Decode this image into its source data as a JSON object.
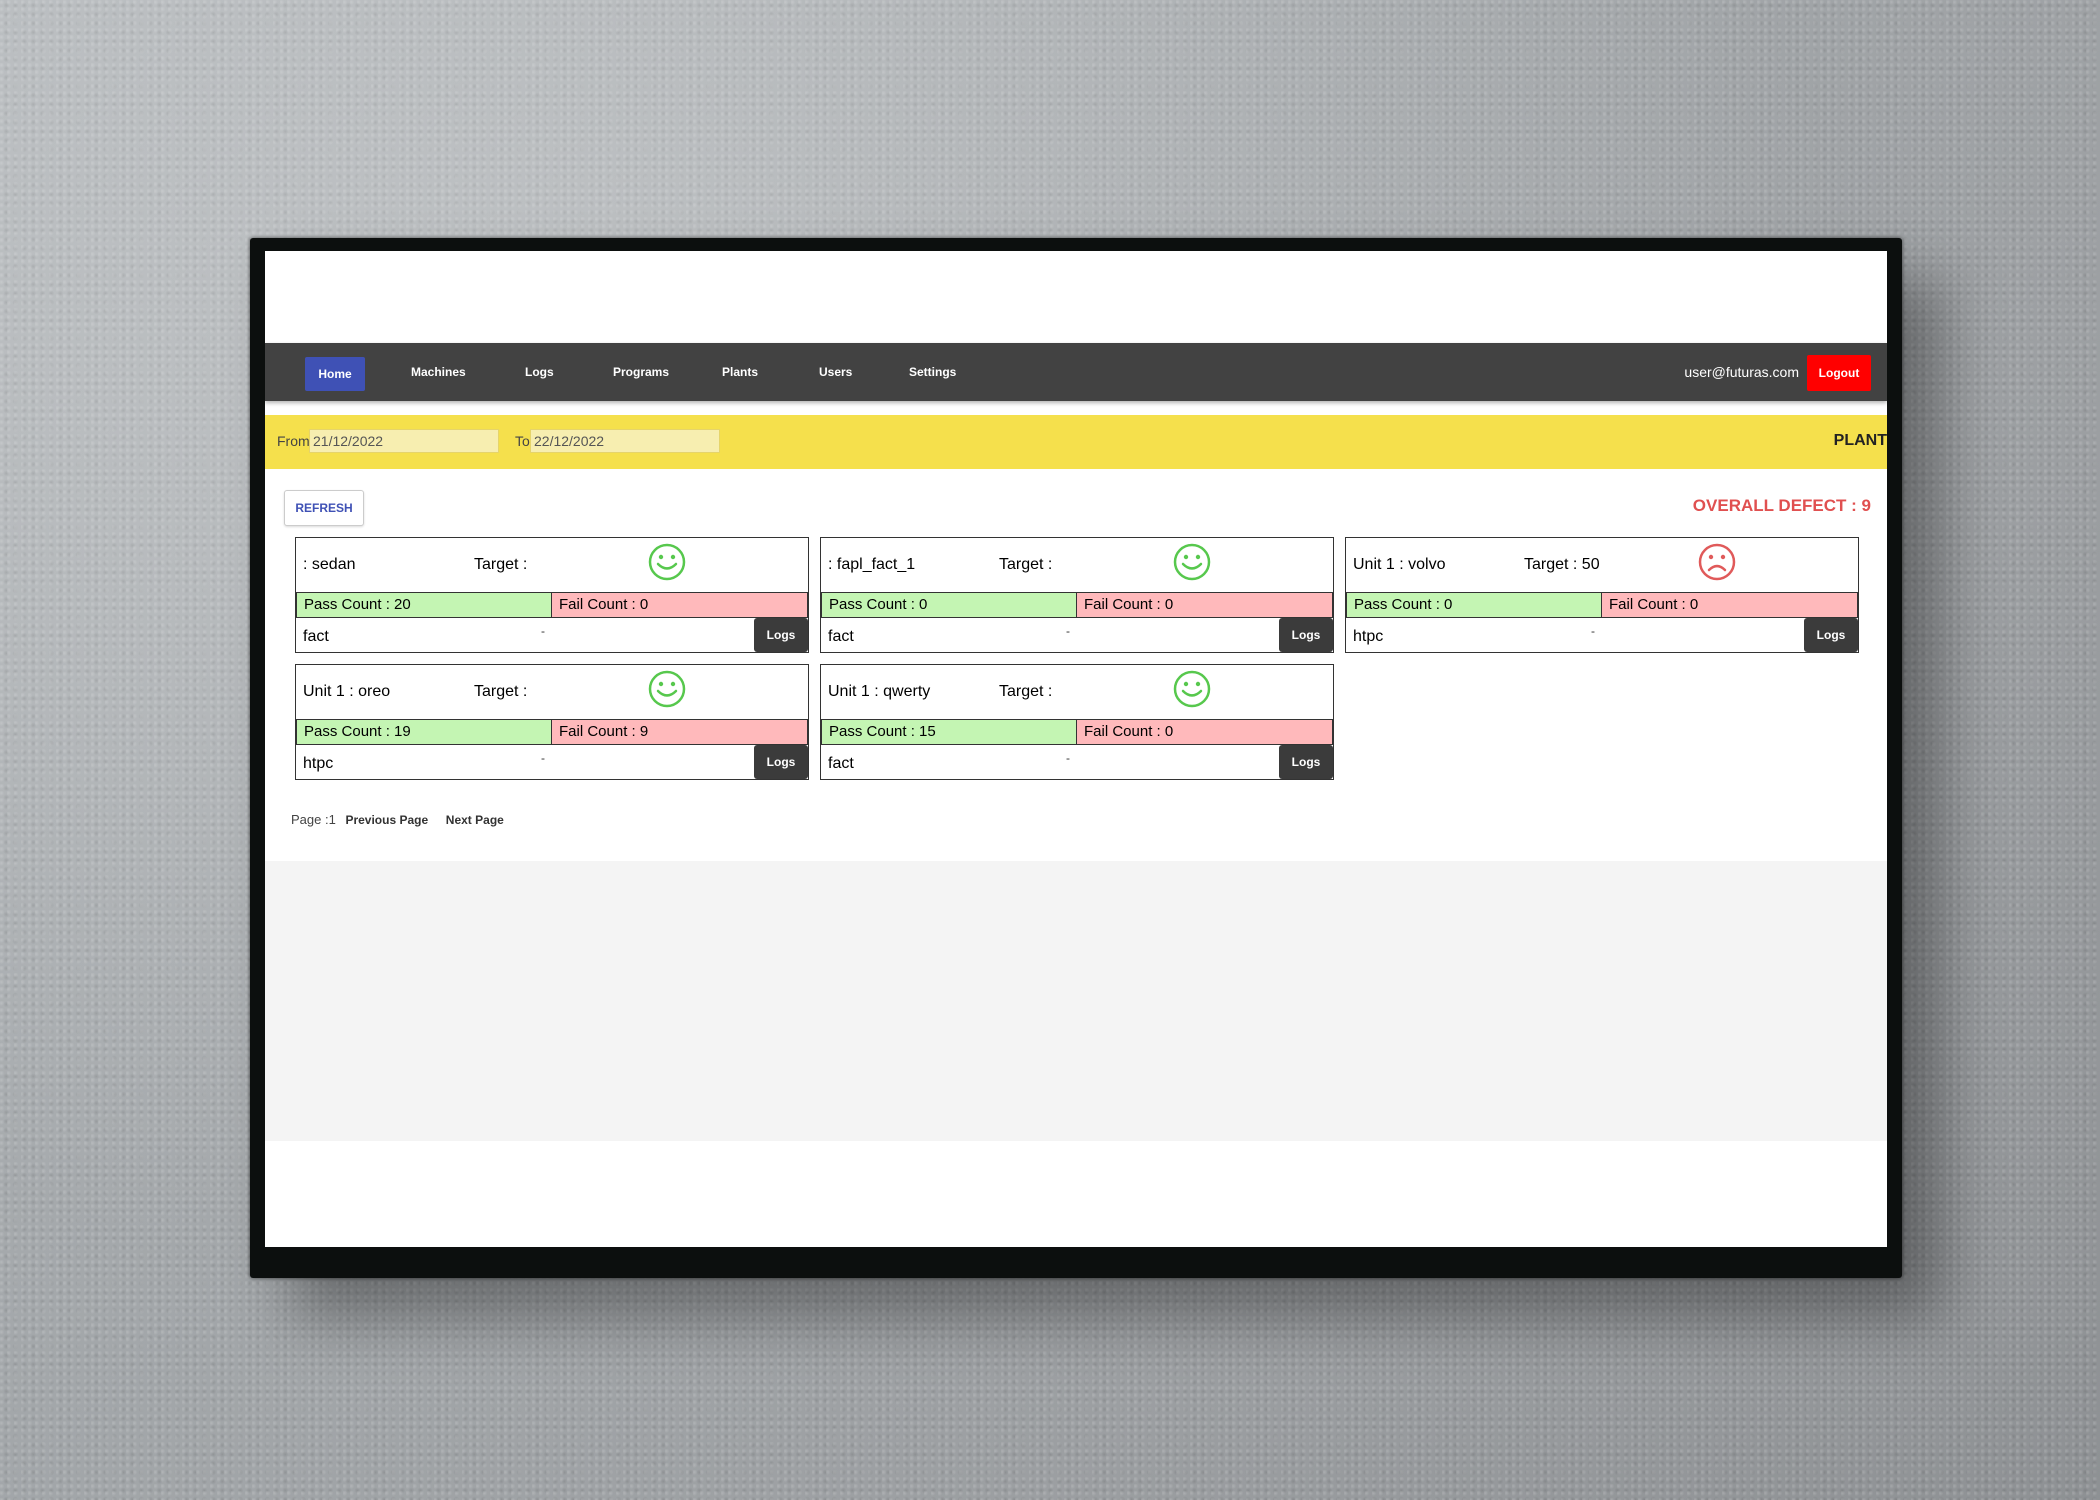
{
  "nav": {
    "items": [
      "Home",
      "Machines",
      "Logs",
      "Programs",
      "Plants",
      "Users",
      "Settings"
    ],
    "active": "Home",
    "user_email": "user@futuras.com",
    "logout_label": "Logout"
  },
  "filters": {
    "from_label": "From",
    "from_value": "21/12/2022",
    "to_label": "To",
    "to_value": "22/12/2022",
    "plant_label": "PLANT"
  },
  "toolbar": {
    "refresh_label": "REFRESH",
    "overall_defect": "OVERALL DEFECT : 9"
  },
  "cards": [
    {
      "name": ": sedan",
      "target": "Target :",
      "status": "happy",
      "pass": "Pass Count : 20",
      "fail": "Fail Count : 0",
      "plant": "fact",
      "dash": "-",
      "logs_label": "Logs"
    },
    {
      "name": ": fapl_fact_1",
      "target": "Target :",
      "status": "happy",
      "pass": "Pass Count : 0",
      "fail": "Fail Count : 0",
      "plant": "fact",
      "dash": "-",
      "logs_label": "Logs"
    },
    {
      "name": "Unit 1 : volvo",
      "target": "Target : 50",
      "status": "sad",
      "pass": "Pass Count : 0",
      "fail": "Fail Count : 0",
      "plant": "htpc",
      "dash": "-",
      "logs_label": "Logs"
    },
    {
      "name": "Unit 1 : oreo",
      "target": "Target :",
      "status": "happy",
      "pass": "Pass Count : 19",
      "fail": "Fail Count : 9",
      "plant": "htpc",
      "dash": "-",
      "logs_label": "Logs"
    },
    {
      "name": "Unit 1 : qwerty",
      "target": "Target :",
      "status": "happy",
      "pass": "Pass Count : 15",
      "fail": "Fail Count : 0",
      "plant": "fact",
      "dash": "-",
      "logs_label": "Logs"
    }
  ],
  "pagination": {
    "page_text": "Page :1",
    "previous_label": "Previous Page",
    "next_label": "Next Page"
  },
  "colors": {
    "navbar": "#424242",
    "active_nav": "#3f51b5",
    "logout": "#ff0000",
    "filter_bar": "#f5e04c",
    "pass": "#c4f5b3",
    "fail": "#ffb9bb",
    "happy_face": "#57c84d",
    "sad_face": "#e05a5a",
    "defect_text": "#e05050"
  }
}
